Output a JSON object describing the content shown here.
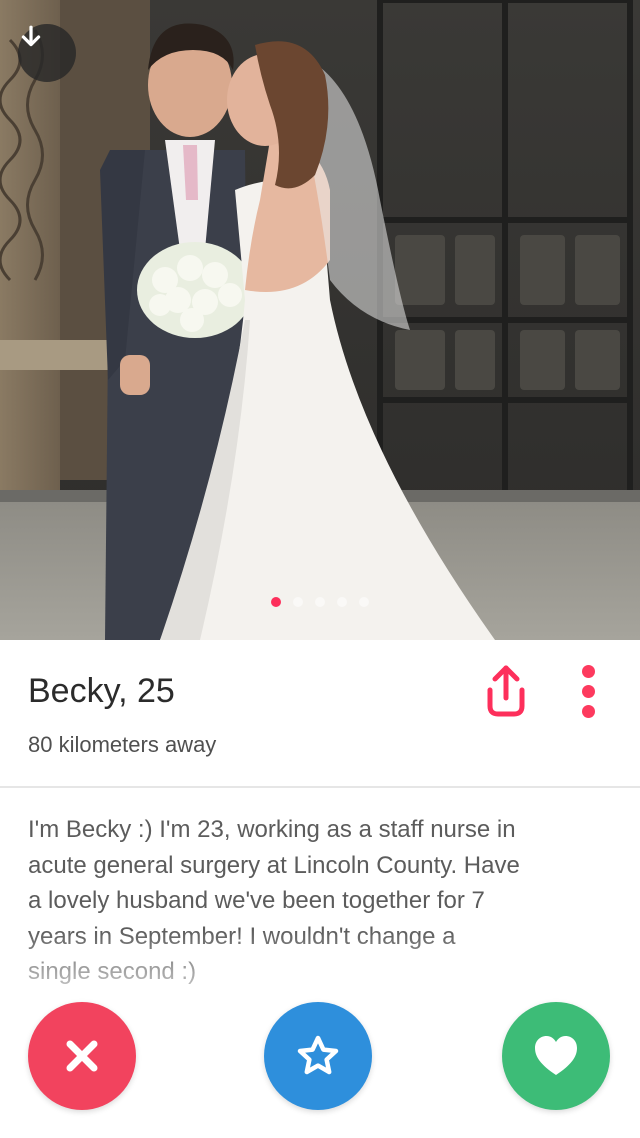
{
  "profile": {
    "name_age": "Becky, 25",
    "distance": "80 kilometers away",
    "bio": "I'm Becky :) I'm 23, working as a staff nurse in\nacute general surgery at Lincoln County. Have\na lovely husband we've been together for 7\nyears in September! I wouldn't change a\nsingle second :)"
  },
  "photo": {
    "description_icon": "wedding-photo",
    "photo_count": 5,
    "active_index": 0
  },
  "icons": {
    "back": "arrow-down-icon",
    "share": "share-icon",
    "more": "more-vertical-icon",
    "nope": "x-icon",
    "super_like": "star-icon",
    "like": "heart-icon"
  },
  "colors": {
    "accent": "#fd2f5b",
    "nope": "#f2435e",
    "super_like": "#2e8fdc",
    "like": "#3dbc77",
    "text_primary": "#2b2b2b",
    "text_secondary": "#505050",
    "bio_text": "#5c5c5c"
  }
}
